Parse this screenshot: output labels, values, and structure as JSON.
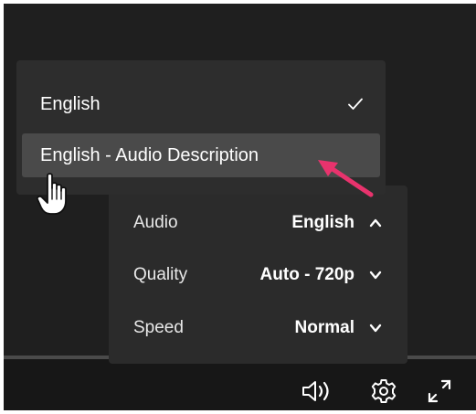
{
  "audio_menu": {
    "items": [
      {
        "label": "English",
        "checked": true
      },
      {
        "label": "English - Audio Description",
        "checked": false,
        "hovered": true
      }
    ]
  },
  "settings_menu": {
    "rows": [
      {
        "label": "Audio",
        "value": "English",
        "chevron": "chevron-up-icon"
      },
      {
        "label": "Quality",
        "value": "Auto - 720p",
        "chevron": "chevron-down-icon"
      },
      {
        "label": "Speed",
        "value": "Normal",
        "chevron": "chevron-down-icon"
      }
    ]
  },
  "control_bar": {
    "icons": [
      "volume-icon",
      "settings-gear-icon",
      "fullscreen-icon"
    ]
  },
  "annotation": {
    "arrow_color": "#e8336d"
  },
  "colors": {
    "player_bg": "#1f1f1f",
    "menu_bg": "#2b2b2b",
    "hover_bg": "#4a4a4a",
    "text": "#ffffff"
  }
}
